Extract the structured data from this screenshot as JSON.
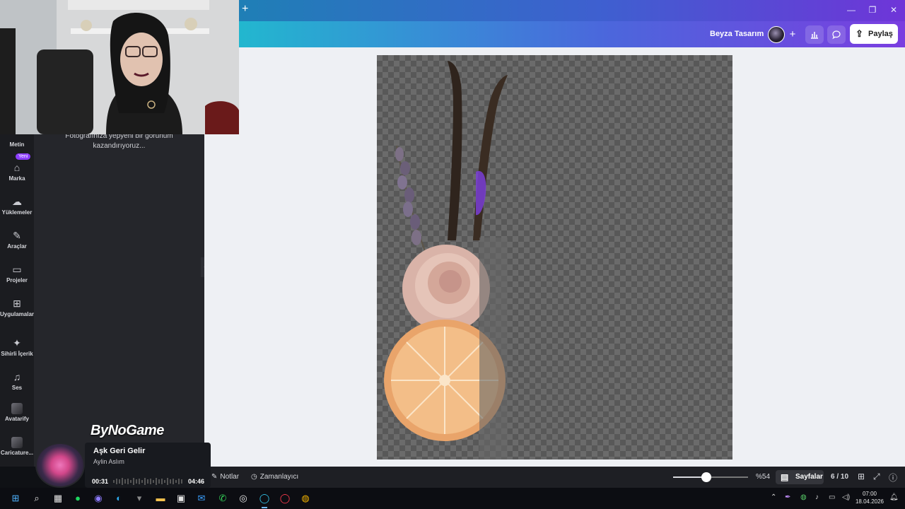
{
  "window": {
    "new_tab": "+",
    "minimize": "—",
    "restore": "❐",
    "close": "✕"
  },
  "header": {
    "design_title": "Beyza Tasarım",
    "share_label": "Paylaş",
    "add_icon": "plus-icon",
    "analytics_icon": "bar-chart-icon",
    "comment_icon": "comment-icon"
  },
  "rail": {
    "items": [
      {
        "label": "Metin",
        "icon": "text-icon"
      },
      {
        "label": "Marka",
        "icon": "brand-icon",
        "badge": "Yeni"
      },
      {
        "label": "Yüklemeler",
        "icon": "upload-cloud-icon"
      },
      {
        "label": "Araçlar",
        "icon": "pen-icon"
      },
      {
        "label": "Projeler",
        "icon": "folder-icon"
      },
      {
        "label": "Uygulamalar",
        "icon": "apps-icon"
      },
      {
        "label": "Sihirli İçerik",
        "icon": "magic-image-icon"
      },
      {
        "label": "Ses",
        "icon": "music-note-icon"
      },
      {
        "label": "Avatarify",
        "icon": "avatarify-app-icon"
      },
      {
        "label": "Caricature...",
        "icon": "caricature-app-icon"
      }
    ]
  },
  "panel": {
    "description": "Fotoğrafınıza yepyeni bir görünüm kazandırıyoruz..."
  },
  "bottombar": {
    "notes_label": "Notlar",
    "timer_label": "Zamanlayıcı",
    "zoom_label": "%54",
    "zoom_fraction": 0.44,
    "pages_label": "Sayfalar",
    "page_counter": "6 / 10"
  },
  "music": {
    "brand": "ByNoGame",
    "title": "Aşk Geri Gelir",
    "artist": "Aylin Aslım",
    "elapsed": "00:31",
    "total": "04:46"
  },
  "taskbar": {
    "time": "07:00",
    "date": "18.04.2026"
  }
}
